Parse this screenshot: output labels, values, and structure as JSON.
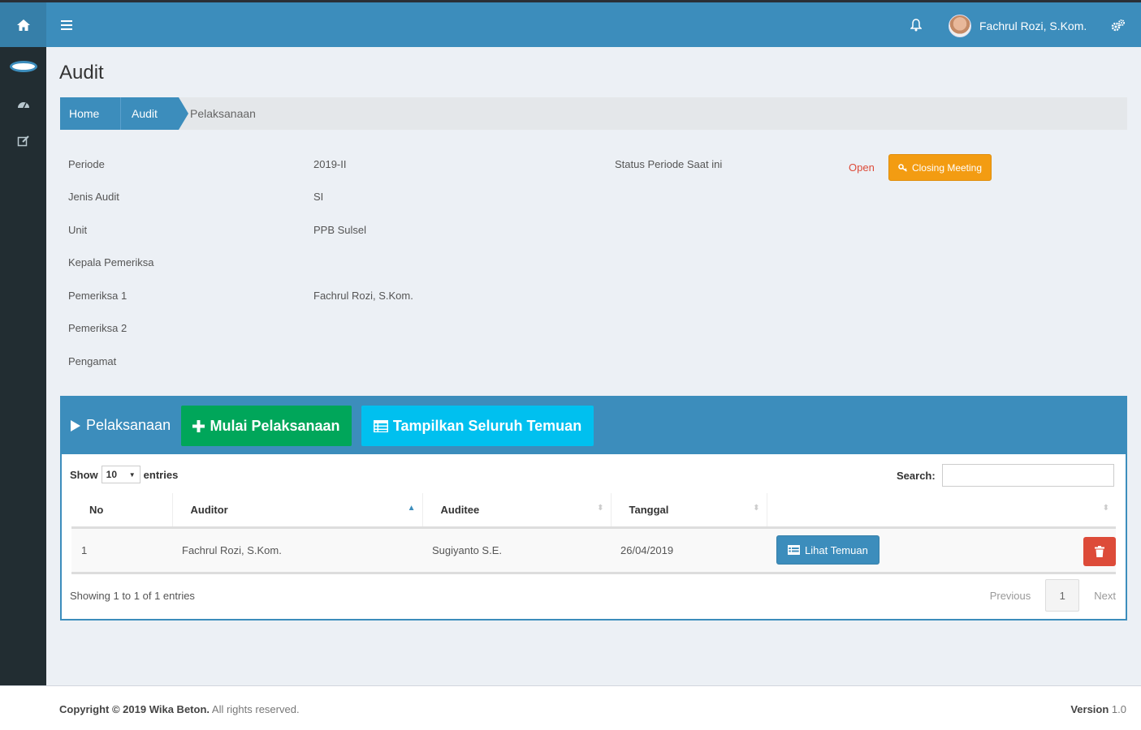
{
  "topbar": {
    "user_name": "Fachrul Rozi, S.Kom."
  },
  "page": {
    "title": "Audit"
  },
  "breadcrumb": {
    "home": "Home",
    "audit": "Audit",
    "current": "Pelaksanaan"
  },
  "info": {
    "periode_label": "Periode",
    "periode_value": "2019-II",
    "jenis_label": "Jenis Audit",
    "jenis_value": "SI",
    "unit_label": "Unit",
    "unit_value": "PPB Sulsel",
    "kepala_label": "Kepala Pemeriksa",
    "kepala_value": "",
    "pemeriksa1_label": "Pemeriksa 1",
    "pemeriksa1_value": "Fachrul Rozi, S.Kom.",
    "pemeriksa2_label": "Pemeriksa 2",
    "pemeriksa2_value": "",
    "pengamat_label": "Pengamat",
    "pengamat_value": "",
    "status_label": "Status Periode Saat ini",
    "status_value": "Open",
    "closing_button": "Closing Meeting"
  },
  "panel": {
    "title": "Pelaksanaan",
    "mulai_button": "Mulai Pelaksanaan",
    "tampilkan_button": "Tampilkan Seluruh Temuan",
    "show_label": "Show",
    "entries_value": "10",
    "entries_label": "entries",
    "search_label": "Search:",
    "search_value": "",
    "columns": [
      "No",
      "Auditor",
      "Auditee",
      "Tanggal",
      ""
    ],
    "rows": [
      {
        "no": "1",
        "auditor": "Fachrul Rozi, S.Kom.",
        "auditee": "Sugiyanto S.E.",
        "tanggal": "26/04/2019",
        "action": "Lihat Temuan"
      }
    ],
    "showing_text": "Showing 1 to 1 of 1 entries",
    "previous": "Previous",
    "page": "1",
    "next": "Next"
  },
  "footer": {
    "copyright_bold": "Copyright © 2019 Wika Beton.",
    "copyright_rest": "All rights reserved.",
    "version_label": "Version",
    "version_value": "1.0"
  },
  "colors": {
    "primary": "#3c8dbc",
    "success": "#00a65a",
    "info": "#00c0ef",
    "warning": "#f39c12",
    "danger": "#dd4b39",
    "sidebar": "#222d32"
  }
}
